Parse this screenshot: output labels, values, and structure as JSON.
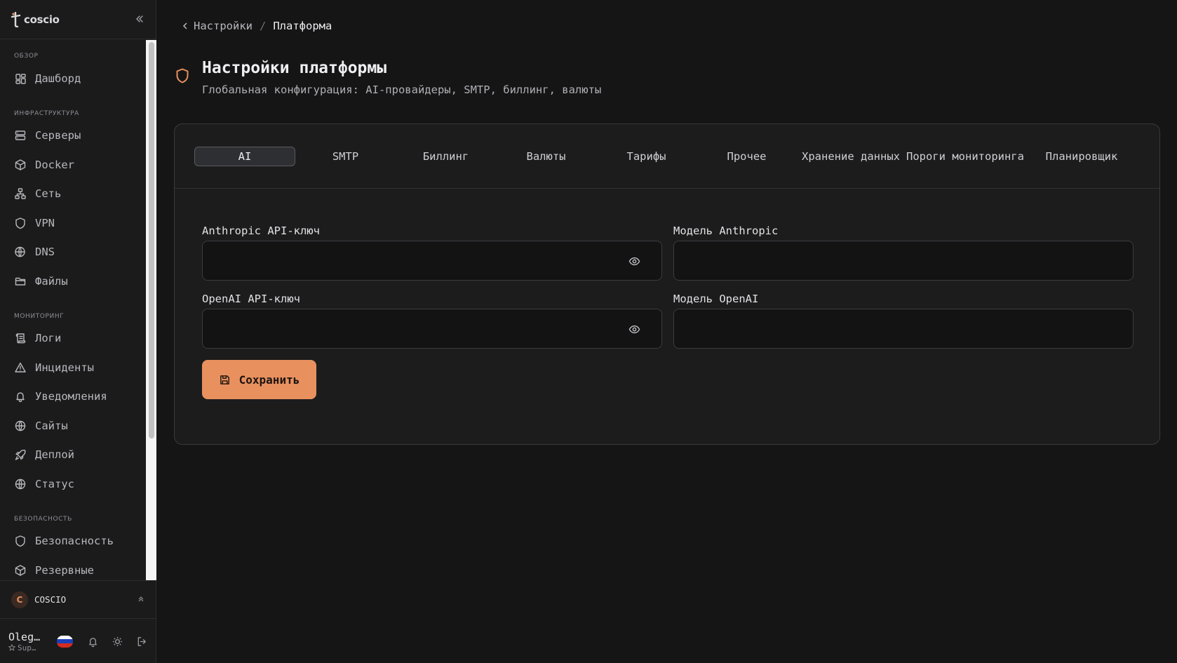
{
  "brand": {
    "name": "coscio"
  },
  "sidebar": {
    "sections": [
      {
        "label": "ОБЗОР",
        "items": [
          {
            "label": "Дашборд",
            "icon": "dashboard-icon"
          }
        ]
      },
      {
        "label": "ИНФРАСТРУКТУРА",
        "items": [
          {
            "label": "Серверы",
            "icon": "server-icon"
          },
          {
            "label": "Docker",
            "icon": "box-icon"
          },
          {
            "label": "Сеть",
            "icon": "network-icon"
          },
          {
            "label": "VPN",
            "icon": "shield-icon"
          },
          {
            "label": "DNS",
            "icon": "globe-lock-icon"
          },
          {
            "label": "Файлы",
            "icon": "folder-icon"
          }
        ]
      },
      {
        "label": "МОНИТОРИНГ",
        "items": [
          {
            "label": "Логи",
            "icon": "scroll-icon"
          },
          {
            "label": "Инциденты",
            "icon": "alert-triangle-icon"
          },
          {
            "label": "Уведомления",
            "icon": "bell-icon"
          },
          {
            "label": "Сайты",
            "icon": "globe-icon"
          },
          {
            "label": "Деплой",
            "icon": "rocket-icon"
          },
          {
            "label": "Статус",
            "icon": "globe-icon"
          }
        ]
      },
      {
        "label": "БЕЗОПАСНОСТЬ",
        "items": [
          {
            "label": "Безопасность",
            "icon": "shield-icon"
          },
          {
            "label": "Резервные",
            "icon": "box-icon"
          }
        ]
      }
    ],
    "org": {
      "initial": "C",
      "name": "COSCIO"
    },
    "user": {
      "name": "Oleg…",
      "role": "Sup…"
    }
  },
  "breadcrumb": {
    "back": "Настройки",
    "separator": "/",
    "current": "Платформа"
  },
  "page": {
    "title": "Настройки платформы",
    "subtitle": "Глобальная конфигурация: AI-провайдеры, SMTP, биллинг, валюты"
  },
  "tabs": [
    "AI",
    "SMTP",
    "Биллинг",
    "Валюты",
    "Тарифы",
    "Прочее",
    "Хранение данных",
    "Пороги мониторинга",
    "Планировщик"
  ],
  "form": {
    "anthropic_key_label": "Anthropic API-ключ",
    "anthropic_model_label": "Модель Anthropic",
    "openai_key_label": "OpenAI API-ключ",
    "openai_model_label": "Модель OpenAI",
    "anthropic_key_value": "",
    "anthropic_model_value": "",
    "openai_key_value": "",
    "openai_model_value": "",
    "save_label": "Сохранить"
  },
  "colors": {
    "accent": "#e8905e",
    "background": "#151516",
    "card": "#1c1c1d"
  }
}
